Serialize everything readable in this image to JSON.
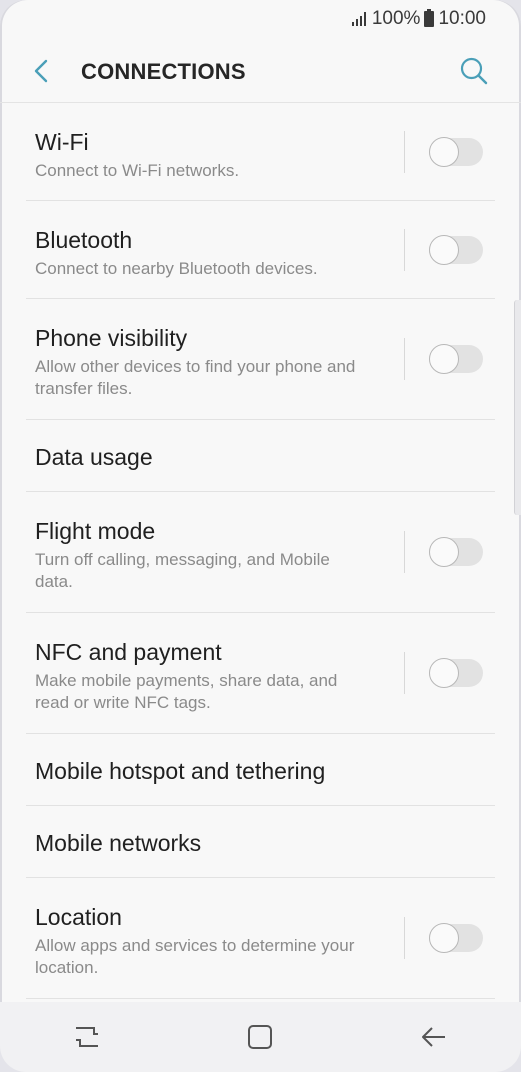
{
  "status_bar": {
    "battery_percent": "100%",
    "time": "10:00",
    "icons": [
      "signal-icon",
      "battery-icon"
    ]
  },
  "header": {
    "title": "CONNECTIONS",
    "back_icon": "chevron-left-icon",
    "search_icon": "search-icon"
  },
  "settings": [
    {
      "label": "Wi-Fi",
      "sub": "Connect to Wi-Fi networks.",
      "toggle": "off"
    },
    {
      "label": "Bluetooth",
      "sub": "Connect to nearby Bluetooth devices.",
      "toggle": "off"
    },
    {
      "label": "Phone visibility",
      "sub": "Allow other devices to find your phone and transfer files.",
      "toggle": "off"
    },
    {
      "label": "Data usage"
    },
    {
      "label": "Flight mode",
      "sub": "Turn off calling, messaging, and Mobile data.",
      "toggle": "off"
    },
    {
      "label": "NFC and payment",
      "sub": "Make mobile payments, share data, and read or write NFC tags.",
      "toggle": "off"
    },
    {
      "label": "Mobile hotspot and tethering"
    },
    {
      "label": "Mobile networks"
    },
    {
      "label": "Location",
      "sub": "Allow apps and services to determine your location.",
      "toggle": "off"
    }
  ],
  "nav_bar": {
    "icons": [
      "recent-apps-icon",
      "home-icon",
      "back-arrow-icon"
    ]
  },
  "colors": {
    "accent": "#4a9fb8",
    "background": "#f8f8f8"
  }
}
